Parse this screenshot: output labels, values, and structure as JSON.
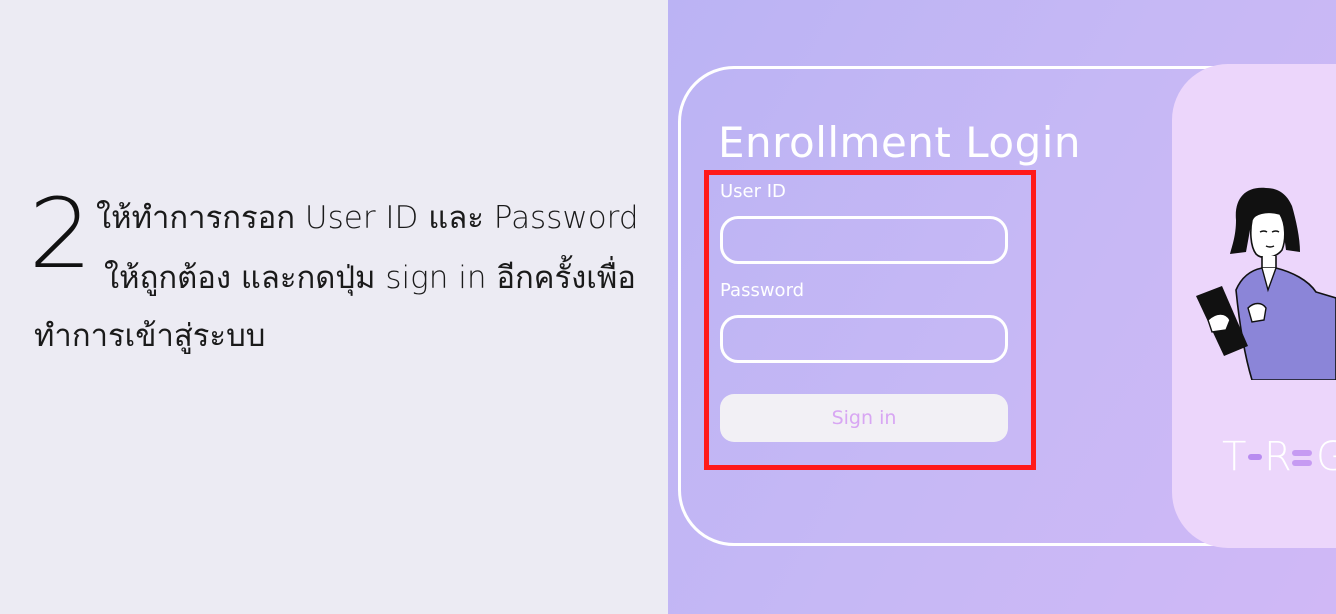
{
  "instructions": {
    "step_number": "2",
    "line1": "ให้ทำการกรอก User ID และ Password",
    "line2": "ให้ถูกต้อง และกดปุ่ม sign in อีกครั้งเพื่อ",
    "line3": "ทำการเข้าสู่ระบบ"
  },
  "login": {
    "title": "Enrollment Login",
    "user_label": "User ID",
    "user_value": "",
    "password_label": "Password",
    "password_value": "",
    "signin_label": "Sign in"
  },
  "logo": {
    "letters": [
      "T",
      "R",
      "G"
    ]
  },
  "colors": {
    "highlight": "#ff1a1a",
    "panel_bg": "#c6b8f5",
    "brand_panel": "#ecd6fb",
    "signin_text": "#d8a6f3"
  },
  "icons": {
    "illustration": "person-holding-tablet-illustration",
    "logo": "t-reg-logo"
  }
}
